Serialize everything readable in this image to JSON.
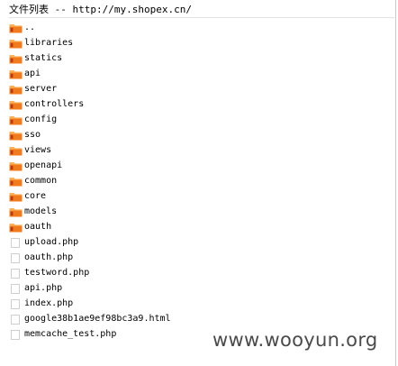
{
  "header": {
    "title": "文件列表 -- http://my.shopex.cn/"
  },
  "entries": [
    {
      "name": "..",
      "type": "folder",
      "icon": "folder-icon"
    },
    {
      "name": "libraries",
      "type": "folder",
      "icon": "folder-icon"
    },
    {
      "name": "statics",
      "type": "folder",
      "icon": "folder-icon"
    },
    {
      "name": "api",
      "type": "folder",
      "icon": "folder-icon"
    },
    {
      "name": "server",
      "type": "folder",
      "icon": "folder-icon"
    },
    {
      "name": "controllers",
      "type": "folder",
      "icon": "folder-icon"
    },
    {
      "name": "config",
      "type": "folder",
      "icon": "folder-icon"
    },
    {
      "name": "sso",
      "type": "folder",
      "icon": "folder-icon"
    },
    {
      "name": "views",
      "type": "folder",
      "icon": "folder-icon"
    },
    {
      "name": "openapi",
      "type": "folder",
      "icon": "folder-icon"
    },
    {
      "name": "common",
      "type": "folder",
      "icon": "folder-icon"
    },
    {
      "name": "core",
      "type": "folder",
      "icon": "folder-icon"
    },
    {
      "name": "models",
      "type": "folder",
      "icon": "folder-icon"
    },
    {
      "name": "oauth",
      "type": "folder",
      "icon": "folder-icon"
    },
    {
      "name": "upload.php",
      "type": "file",
      "icon": "file-icon"
    },
    {
      "name": "oauth.php",
      "type": "file",
      "icon": "file-icon"
    },
    {
      "name": "testword.php",
      "type": "file",
      "icon": "file-icon"
    },
    {
      "name": "api.php",
      "type": "file",
      "icon": "file-icon"
    },
    {
      "name": "index.php",
      "type": "file",
      "icon": "file-icon"
    },
    {
      "name": "google38b1ae9ef98bc3a9.html",
      "type": "file",
      "icon": "file-icon"
    },
    {
      "name": "memcache_test.php",
      "type": "file",
      "icon": "file-icon"
    }
  ],
  "watermark": {
    "text": "www.wooyun.org"
  },
  "colors": {
    "folder_body": "#f07a1e",
    "folder_tab": "#f9b15a",
    "folder_mark": "#b93a10",
    "file_border": "#cfcfcf",
    "watermark": "#4a4a4a"
  }
}
